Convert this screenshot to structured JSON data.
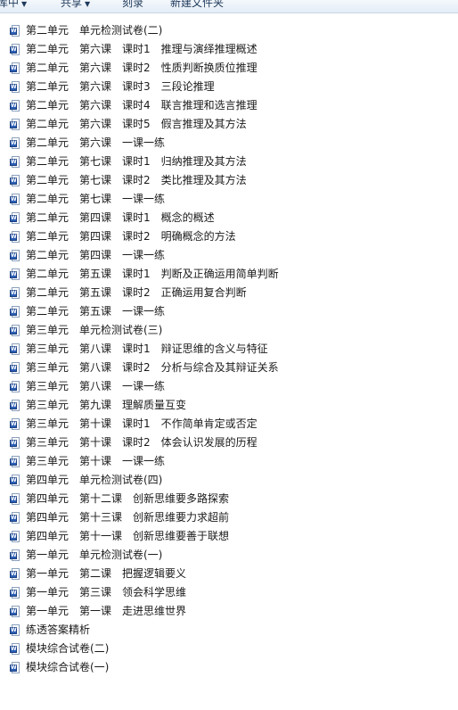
{
  "toolbar": {
    "items": [
      {
        "label": "库中",
        "has_dropdown": true
      },
      {
        "label": "共享",
        "has_dropdown": true
      },
      {
        "label": "刻录",
        "has_dropdown": false
      },
      {
        "label": "新建文件夹",
        "has_dropdown": false
      }
    ]
  },
  "file_icon": "word-document-icon",
  "files": [
    "第二单元　单元检测试卷(二)",
    "第二单元　第六课　课时1　推理与演绎推理概述",
    "第二单元　第六课　课时2　性质判断换质位推理",
    "第二单元　第六课　课时3　三段论推理",
    "第二单元　第六课　课时4　联言推理和选言推理",
    "第二单元　第六课　课时5　假言推理及其方法",
    "第二单元　第六课　一课一练",
    "第二单元　第七课　课时1　归纳推理及其方法",
    "第二单元　第七课　课时2　类比推理及其方法",
    "第二单元　第七课　一课一练",
    "第二单元　第四课　课时1　概念的概述",
    "第二单元　第四课　课时2　明确概念的方法",
    "第二单元　第四课　一课一练",
    "第二单元　第五课　课时1　判断及正确运用简单判断",
    "第二单元　第五课　课时2　正确运用复合判断",
    "第二单元　第五课　一课一练",
    "第三单元　单元检测试卷(三)",
    "第三单元　第八课　课时1　辩证思维的含义与特征",
    "第三单元　第八课　课时2　分析与综合及其辩证关系",
    "第三单元　第八课　一课一练",
    "第三单元　第九课　理解质量互变",
    "第三单元　第十课　课时1　不作简单肯定或否定",
    "第三单元　第十课　课时2　体会认识发展的历程",
    "第三单元　第十课　一课一练",
    "第四单元　单元检测试卷(四)",
    "第四单元　第十二课　创新思维要多路探索",
    "第四单元　第十三课　创新思维要力求超前",
    "第四单元　第十一课　创新思维要善于联想",
    "第一单元　单元检测试卷(一)",
    "第一单元　第二课　把握逻辑要义",
    "第一单元　第三课　领会科学思维",
    "第一单元　第一课　走进思维世界",
    "练透答案精析",
    "模块综合试卷(二)",
    "模块综合试卷(一)"
  ]
}
